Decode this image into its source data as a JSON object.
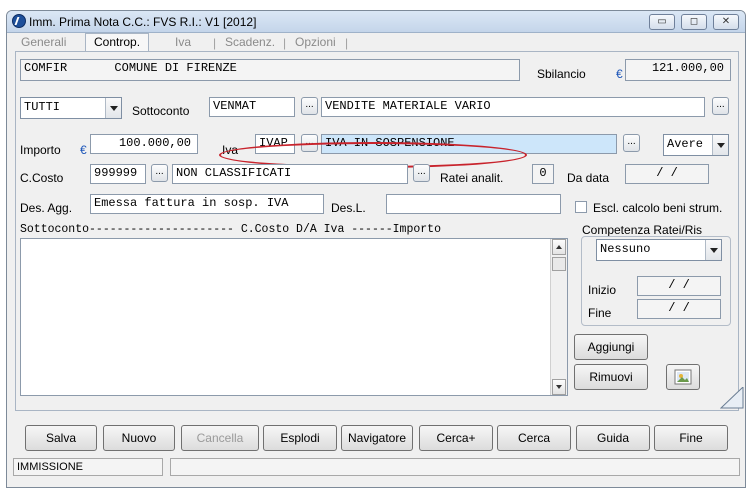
{
  "window": {
    "title": "Imm. Prima Nota C.C.: FVS  R.I.: V1  [2012]"
  },
  "tabs": [
    "Generali",
    "Controp.",
    "Iva",
    "Scadenz.",
    "Opzioni"
  ],
  "header": {
    "code": "COMFIR",
    "name": "COMUNE DI FIRENZE",
    "sbilancio_label": "Sbilancio",
    "currency": "€",
    "sbilancio_value": "121.000,00"
  },
  "row_sottoconto": {
    "type_select": "TUTTI",
    "label": "Sottoconto",
    "code": "VENMAT",
    "description": "VENDITE MATERIALE VARIO"
  },
  "row_importo": {
    "label": "Importo",
    "currency": "€",
    "value": "100.000,00",
    "iva_label": "Iva",
    "iva_code": "IVAP",
    "iva_description": "IVA IN SOSPENSIONE",
    "sign_select": "Avere"
  },
  "row_ccosto": {
    "label": "C.Costo",
    "code": "999999",
    "description": "NON CLASSIFICATI",
    "ratei_label": "Ratei analit.",
    "ratei_value": "0",
    "da_data_label": "Da data",
    "da_data_value": "/ /"
  },
  "row_desagg": {
    "label": "Des. Agg.",
    "value": "Emessa fattura in sosp. IVA",
    "desl_label": "Des.L.",
    "desl_value": "",
    "escl_label": "Escl. calcolo beni strum."
  },
  "list": {
    "header": "Sottoconto--------------------- C.Costo D/A  Iva  ------Importo"
  },
  "competenza": {
    "title": "Competenza Ratei/Ris",
    "select": "Nessuno",
    "inizio_label": "Inizio",
    "inizio_value": "/ /",
    "fine_label": "Fine",
    "fine_value": "/ /"
  },
  "side_buttons": {
    "aggiungi": "Aggiungi",
    "rimuovi": "Rimuovi"
  },
  "bottom_buttons": [
    "Salva",
    "Nuovo",
    "Cancella",
    "Esplodi",
    "Navigatore",
    "Cerca+",
    "Cerca",
    "Guida",
    "Fine"
  ],
  "status": {
    "mode": "IMMISSIONE",
    "message": ""
  }
}
